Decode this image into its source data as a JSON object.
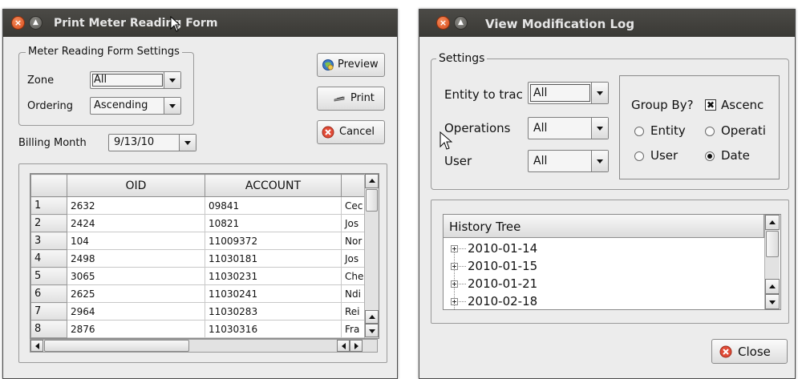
{
  "print_form": {
    "title": "Print Meter Reading Form",
    "settings_legend": "Meter Reading Form Settings",
    "zone_label": "Zone",
    "zone_value": "All",
    "ordering_label": "Ordering",
    "ordering_value": "Ascending",
    "billing_month_label": "Billing Month",
    "billing_month_value": "9/13/10",
    "preview_label": "Preview",
    "print_label": "Print",
    "cancel_label": "Cancel",
    "table": {
      "headers": [
        "",
        "OID",
        "ACCOUNT",
        ""
      ],
      "rows": [
        [
          "1",
          "2632",
          "09841",
          "Cec"
        ],
        [
          "2",
          "2424",
          "10821",
          "Jos"
        ],
        [
          "3",
          "104",
          "11009372",
          "Nor"
        ],
        [
          "4",
          "2498",
          "11030181",
          "Jos"
        ],
        [
          "5",
          "3065",
          "11030231",
          "Che"
        ],
        [
          "6",
          "2625",
          "11030241",
          "Ndi"
        ],
        [
          "7",
          "2964",
          "11030283",
          "Rei"
        ],
        [
          "8",
          "2876",
          "11030316",
          "Fra"
        ]
      ]
    }
  },
  "modification_log": {
    "title": "View Modification Log",
    "settings_legend": "Settings",
    "entity_label": "Entity to trac",
    "entity_value": "All",
    "operations_label": "Operations",
    "operations_value": "All",
    "user_label": "User",
    "user_value": "All",
    "group_by_label": "Group By?",
    "ascending_label": "Ascenc",
    "radio_entity": "Entity",
    "radio_operations": "Operati",
    "radio_user": "User",
    "radio_date": "Date",
    "tree_header": "History Tree",
    "tree_nodes": [
      "2010-01-14",
      "2010-01-15",
      "2010-01-21",
      "2010-02-18"
    ],
    "close_label": "Close"
  }
}
